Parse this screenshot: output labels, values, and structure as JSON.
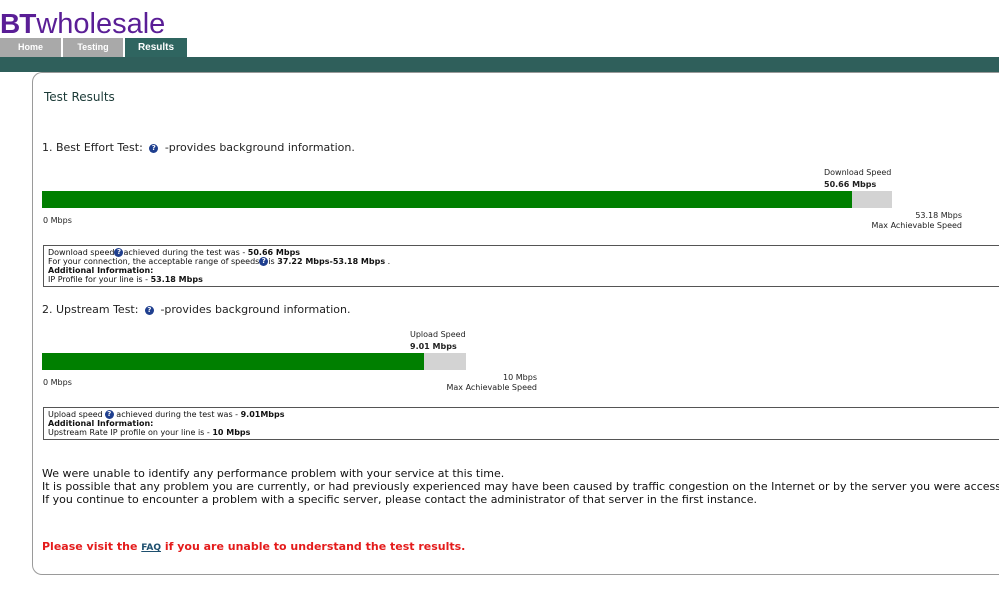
{
  "logo": {
    "bt": "BT",
    "wholesale": "wholesale"
  },
  "tabs": [
    {
      "label": "Home",
      "active": false
    },
    {
      "label": "Testing",
      "active": false
    },
    {
      "label": "Results",
      "active": true
    }
  ],
  "colors": {
    "brand": "#5a1e96",
    "navbar": "#2f5f5b",
    "bar_fill": "#007f00",
    "bar_bg": "#d3d3d3",
    "alert": "#e41b1b"
  },
  "page_title": "Test Results",
  "best_effort": {
    "heading_pre": "1. Best Effort Test:",
    "heading_post": "-provides background information.",
    "speed_label": "Download Speed",
    "speed_value": "50.66 Mbps",
    "min_label": "0 Mbps",
    "max_value": "53.18 Mbps",
    "max_label": "Max Achievable Speed",
    "fill_fraction": 0.9526,
    "info": {
      "line1_pre": "Download speed",
      "line1_mid": "achieved during the test was - ",
      "line1_val": "50.66 Mbps",
      "line2_pre": "For your connection, the acceptable range of speeds",
      "line2_mid": "is ",
      "line2_val": "37.22 Mbps-53.18 Mbps",
      "line2_end": " .",
      "line3": "Additional Information:",
      "line4_pre": "IP Profile for your line is - ",
      "line4_val": "53.18 Mbps"
    }
  },
  "upstream": {
    "heading_pre": "2. Upstream Test:",
    "heading_post": "-provides background information.",
    "speed_label": "Upload Speed",
    "speed_value": "9.01 Mbps",
    "min_label": "0 Mbps",
    "max_value": "10 Mbps",
    "max_label": "Max Achievable Speed",
    "fill_fraction": 0.901,
    "info": {
      "line1_pre": "Upload speed",
      "line1_mid": " achieved during the test was - ",
      "line1_val": "9.01Mbps",
      "line2": "Additional Information:",
      "line3_pre": "Upstream Rate IP profile on your line is - ",
      "line3_val": "10 Mbps"
    }
  },
  "messages": [
    "We were unable to identify any performance problem with your service at this time.",
    "It is possible that any problem you are currently, or had previously experienced may have been caused by traffic congestion on the Internet or by the server you were accessing",
    "If you continue to encounter a problem with a specific server, please contact the administrator of that server in the first instance."
  ],
  "faq": {
    "pre": "Please visit the ",
    "link": "FAQ",
    "post": " if you are unable to understand the test results."
  }
}
